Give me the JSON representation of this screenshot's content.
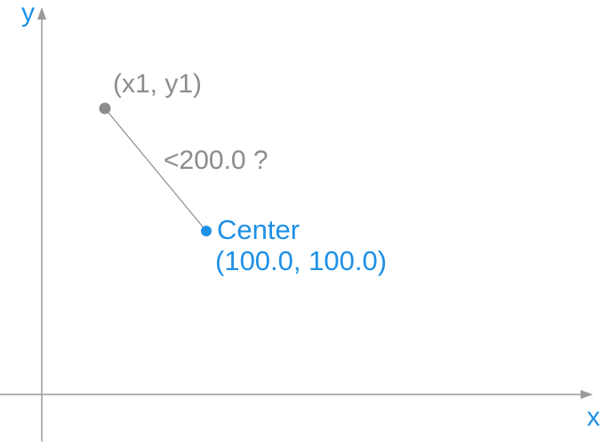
{
  "axes": {
    "x_label": "x",
    "y_label": "y"
  },
  "points": {
    "p1": {
      "label": "(x1, y1)"
    },
    "center": {
      "label": "Center",
      "coords": "(100.0, 100.0)"
    }
  },
  "segment": {
    "label": "<200.0 ?"
  },
  "colors": {
    "axis": "#9a9a9a",
    "axis_label": "#1E90E6",
    "point_gray": "#8c8c8c",
    "point_blue": "#1E90E6"
  }
}
